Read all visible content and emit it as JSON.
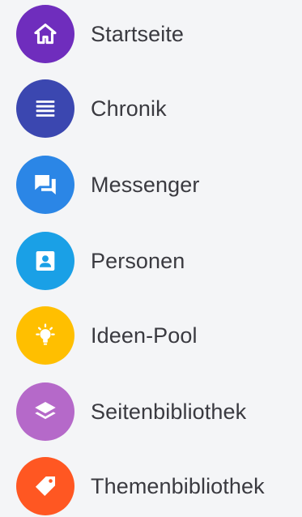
{
  "nav": {
    "items": [
      {
        "label": "Startseite",
        "icon": "home-icon",
        "color": "#6f2dbd"
      },
      {
        "label": "Chronik",
        "icon": "list-icon",
        "color": "#3b47b0"
      },
      {
        "label": "Messenger",
        "icon": "chat-icon",
        "color": "#2b86e6"
      },
      {
        "label": "Personen",
        "icon": "person-card-icon",
        "color": "#1aa0e6"
      },
      {
        "label": "Ideen-Pool",
        "icon": "lightbulb-icon",
        "color": "#ffbf00"
      },
      {
        "label": "Seitenbibliothek",
        "icon": "layers-icon",
        "color": "#b569c9"
      },
      {
        "label": "Themenbibliothek",
        "icon": "tag-icon",
        "color": "#ff5722"
      }
    ]
  }
}
